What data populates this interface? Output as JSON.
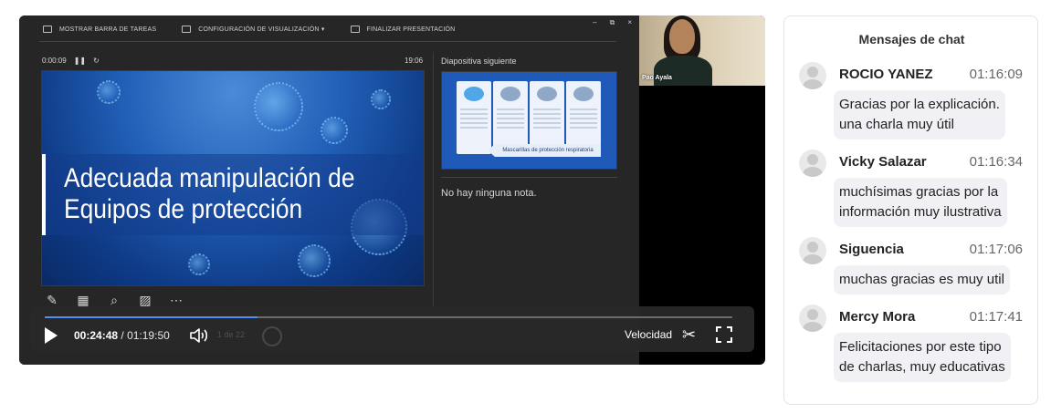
{
  "presenter": {
    "toolbar": {
      "taskbar": "MOSTRAR BARRA DE TAREAS",
      "display_settings": "CONFIGURACIÓN DE VISUALIZACIÓN ▾",
      "end_show": "FINALIZAR PRESENTACIÓN"
    },
    "window_controls": {
      "minimize": "–",
      "restore": "⧉",
      "close": "×"
    },
    "elapsed": "0:00:09",
    "clock": "19:06",
    "next_slide_label": "Diapositiva siguiente",
    "notes": "No hay ninguna nota.",
    "slide_title_line1": "Adecuada manipulación de",
    "slide_title_line2": "Equipos de protección",
    "next_slide_banner": "Mascarillas de protección respiratoria",
    "slide_counter": "1 de 22"
  },
  "webcam": {
    "participant_name": "Pao Ayala"
  },
  "player": {
    "current_time": "00:24:48",
    "separator": "/",
    "duration": "01:19:50",
    "progress_fraction": 0.31,
    "speed_label": "Velocidad",
    "accent_color": "#4f8ff7"
  },
  "chat": {
    "title": "Mensajes de chat",
    "messages": [
      {
        "name": "ROCIO YANEZ",
        "time": "01:16:09",
        "line1": "Gracias por la explicación.",
        "line2": "una charla muy útil"
      },
      {
        "name": "Vicky Salazar",
        "time": "01:16:34",
        "line1": "muchísimas gracias por la",
        "line2": "información muy ilustrativa"
      },
      {
        "name": "Siguencia",
        "time": "01:17:06",
        "line1": "muchas gracias es muy util",
        "line2": ""
      },
      {
        "name": "Mercy Mora",
        "time": "01:17:41",
        "line1": "Felicitaciones por este tipo",
        "line2": "de charlas, muy educativas"
      }
    ]
  }
}
